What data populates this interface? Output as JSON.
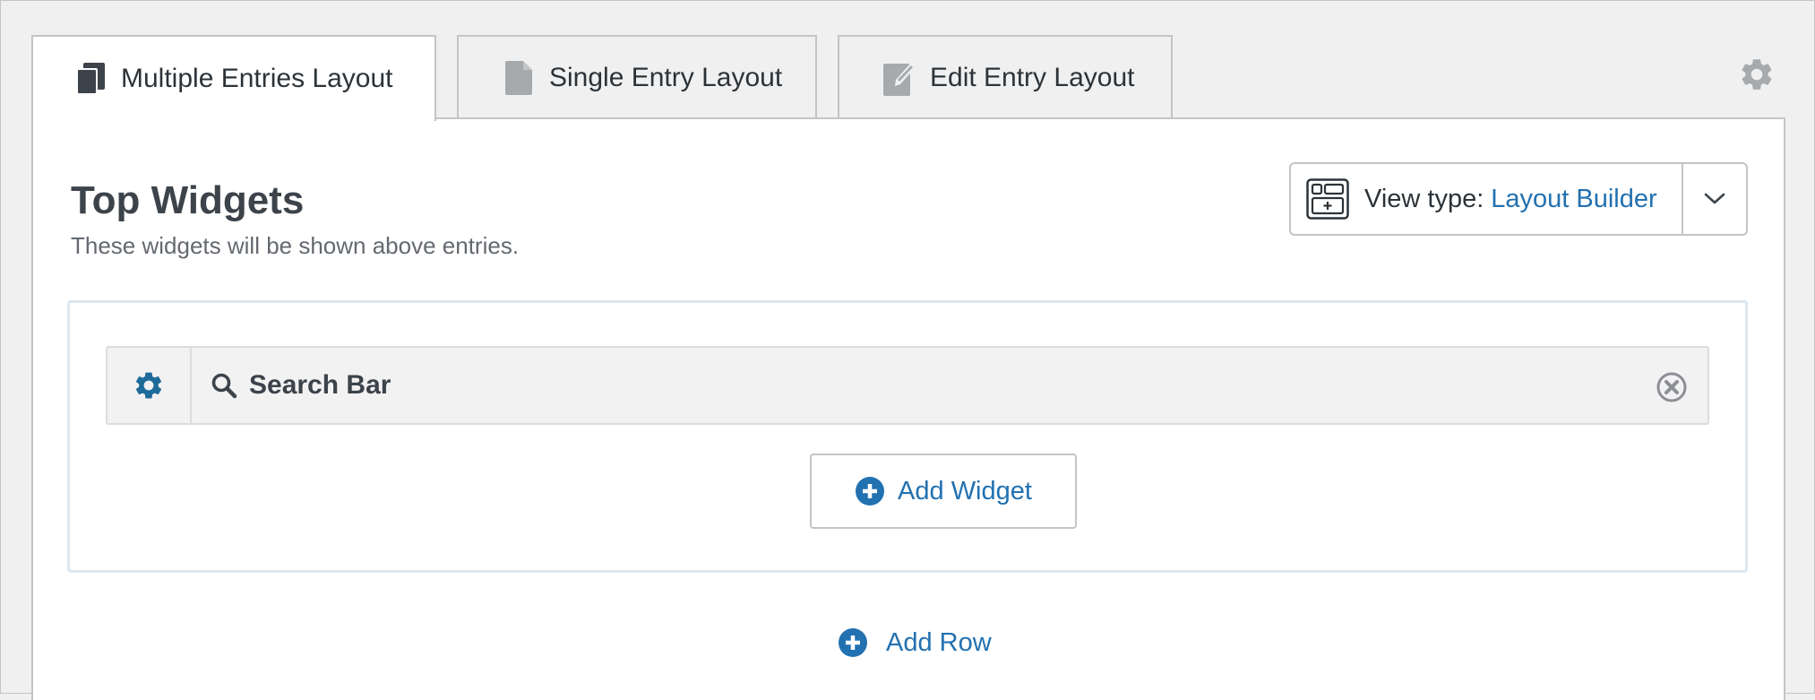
{
  "tabs": [
    {
      "label": "Multiple Entries Layout",
      "icon": "copy-pages-icon",
      "active": true
    },
    {
      "label": "Single Entry Layout",
      "icon": "single-page-icon",
      "active": false
    },
    {
      "label": "Edit Entry Layout",
      "icon": "edit-page-icon",
      "active": false
    }
  ],
  "settings_icon": "gear-icon",
  "section": {
    "title": "Top Widgets",
    "description": "These widgets will be shown above entries."
  },
  "view_type": {
    "label": "View type:",
    "value": "Layout Builder",
    "icon": "layout-builder-icon"
  },
  "widgets": [
    {
      "name": "Search Bar",
      "icon": "search-icon"
    }
  ],
  "add_widget_label": "Add Widget",
  "add_row_label": "Add Row",
  "colors": {
    "accent": "#2271b1",
    "gear_blue": "#1d6b9a",
    "muted_icon": "#a7aaad"
  }
}
